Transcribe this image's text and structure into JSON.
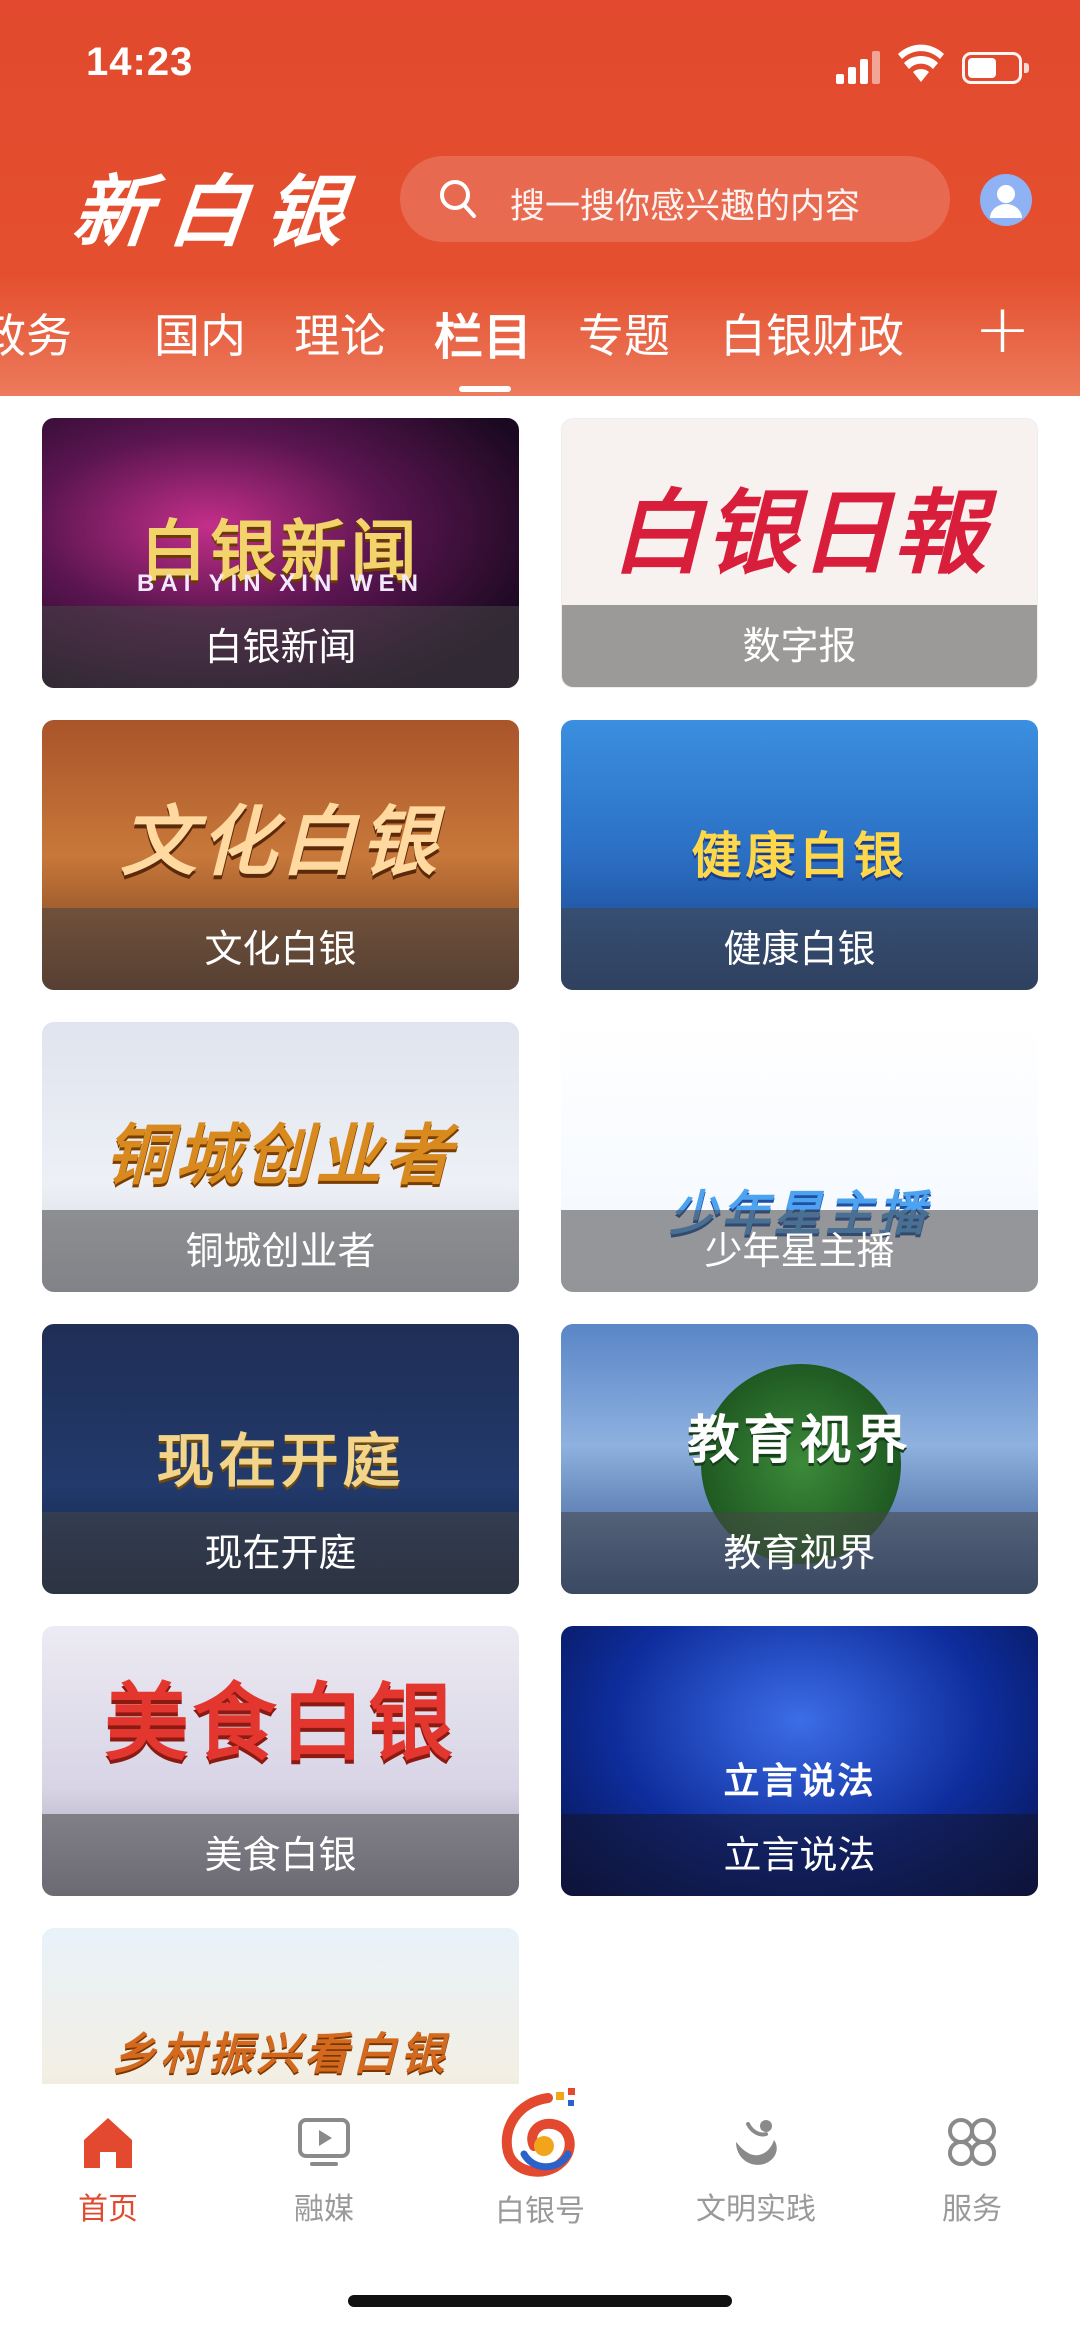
{
  "status_bar": {
    "time": "14:23"
  },
  "header": {
    "logo_text": "新白银",
    "search_placeholder": "搜一搜你感兴趣的内容",
    "tabs": [
      {
        "label": "政务"
      },
      {
        "label": "国内"
      },
      {
        "label": "理论"
      },
      {
        "label": "栏目",
        "active": true
      },
      {
        "label": "专题"
      },
      {
        "label": "白银财政"
      }
    ],
    "add_tab_icon": "plus-icon"
  },
  "grid": {
    "cards": [
      {
        "label": "白银新闻",
        "art_title": "白银新闻",
        "art_subtitle": "BAI YIN XIN WEN"
      },
      {
        "label": "数字报",
        "art_title": "白银日報"
      },
      {
        "label": "文化白银",
        "art_title": "文化白银"
      },
      {
        "label": "健康白银",
        "art_title": "健康白银"
      },
      {
        "label": "铜城创业者",
        "art_title": "铜城创业者"
      },
      {
        "label": "少年星主播",
        "art_title": "少年星主播"
      },
      {
        "label": "现在开庭",
        "art_title": "现在开庭"
      },
      {
        "label": "教育视界",
        "art_title": "教育视界"
      },
      {
        "label": "美食白银",
        "art_title": "美食白银"
      },
      {
        "label": "立言说法",
        "art_title": "立言说法"
      },
      {
        "label": "",
        "art_title": "乡村振兴看白银"
      }
    ]
  },
  "bottom_nav": {
    "items": [
      {
        "label": "首页",
        "icon": "home-icon",
        "active": true
      },
      {
        "label": "融媒",
        "icon": "video-icon"
      },
      {
        "label": "白银号",
        "icon": "baiyin-logo-icon"
      },
      {
        "label": "文明实践",
        "icon": "civilization-icon"
      },
      {
        "label": "服务",
        "icon": "grid-icon"
      }
    ]
  },
  "colors": {
    "brand_red": "#e2492e",
    "inactive_gray": "#9a9a9a"
  }
}
